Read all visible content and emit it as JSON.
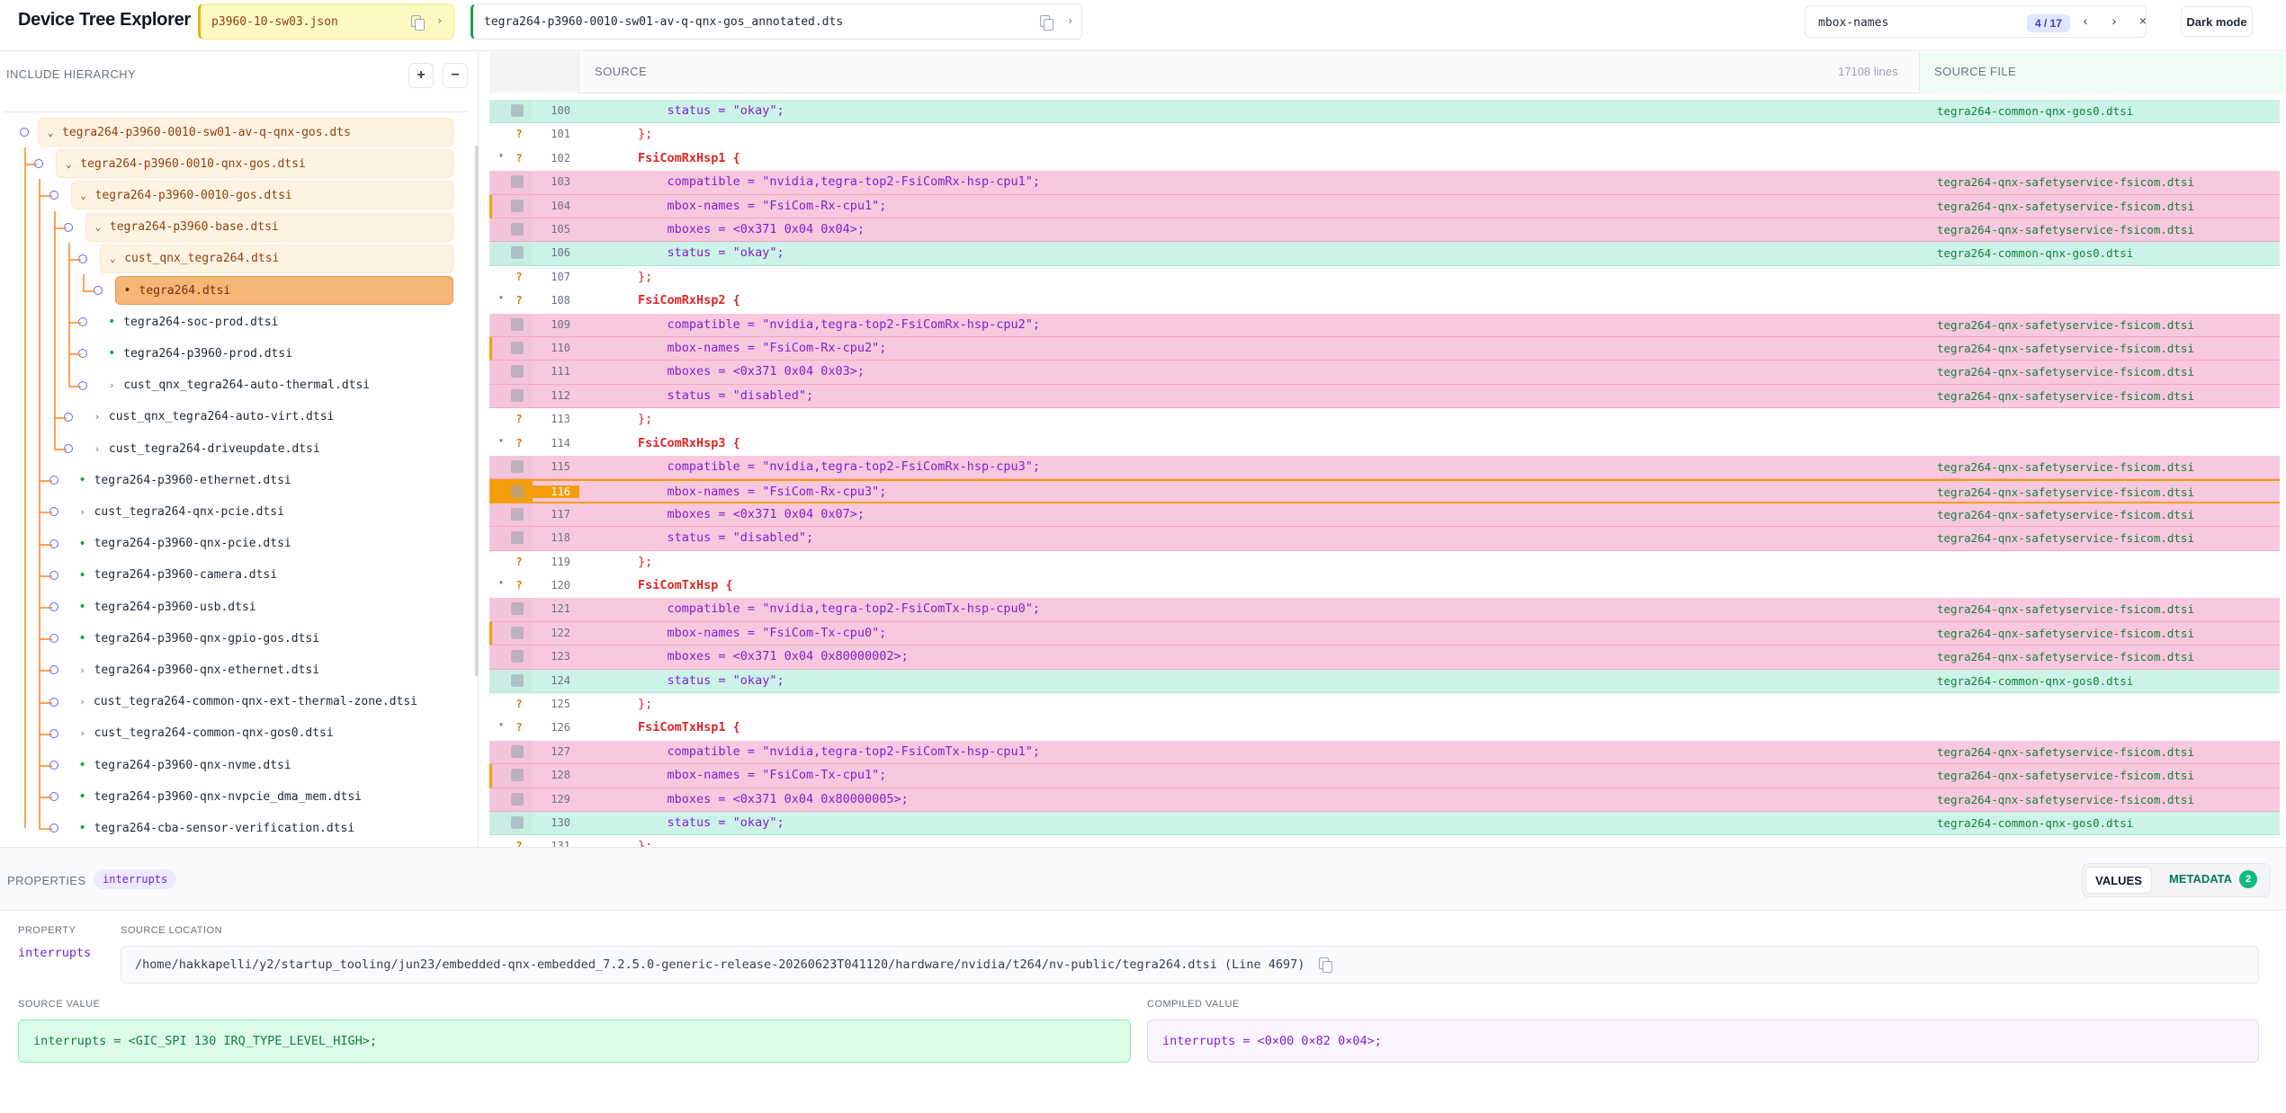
{
  "header": {
    "title": "Device Tree Explorer",
    "file_left": "p3960-10-sw03.json",
    "file_right": "tegra264-p3960-0010-sw01-av-q-qnx-gos_annotated.dts",
    "search_query": "mbox-names",
    "search_count": "4 / 17",
    "dark_mode_label": "Dark mode"
  },
  "sidebar": {
    "title": "INCLUDE HIERARCHY",
    "expand_label": "+",
    "collapse_label": "−",
    "nodes": [
      {
        "label": "tegra264-p3960-0010-sw01-av-q-qnx-gos.dts",
        "state": "open"
      },
      {
        "label": "tegra264-p3960-0010-qnx-gos.dtsi",
        "state": "open"
      },
      {
        "label": "tegra264-p3960-0010-gos.dtsi",
        "state": "open"
      },
      {
        "label": "tegra264-p3960-base.dtsi",
        "state": "open"
      },
      {
        "label": "cust_qnx_tegra264.dtsi",
        "state": "open"
      },
      {
        "label": "tegra264.dtsi",
        "state": "selected"
      },
      {
        "label": "tegra264-soc-prod.dtsi",
        "state": "leaf"
      },
      {
        "label": "tegra264-p3960-prod.dtsi",
        "state": "leaf"
      },
      {
        "label": "cust_qnx_tegra264-auto-thermal.dtsi",
        "state": "closed"
      },
      {
        "label": "cust_qnx_tegra264-auto-virt.dtsi",
        "state": "closed"
      },
      {
        "label": "cust_tegra264-driveupdate.dtsi",
        "state": "closed"
      },
      {
        "label": "tegra264-p3960-ethernet.dtsi",
        "state": "leaf"
      },
      {
        "label": "cust_tegra264-qnx-pcie.dtsi",
        "state": "closed"
      },
      {
        "label": "tegra264-p3960-qnx-pcie.dtsi",
        "state": "leaf"
      },
      {
        "label": "tegra264-p3960-camera.dtsi",
        "state": "leaf"
      },
      {
        "label": "tegra264-p3960-usb.dtsi",
        "state": "leaf"
      },
      {
        "label": "tegra264-p3960-qnx-gpio-gos.dtsi",
        "state": "leaf"
      },
      {
        "label": "tegra264-p3960-qnx-ethernet.dtsi",
        "state": "closed"
      },
      {
        "label": "cust_tegra264-common-qnx-ext-thermal-zone.dtsi",
        "state": "closed"
      },
      {
        "label": "cust_tegra264-common-qnx-gos0.dtsi",
        "state": "closed"
      },
      {
        "label": "tegra264-p3960-qnx-nvme.dtsi",
        "state": "leaf"
      },
      {
        "label": "tegra264-p3960-qnx-nvpcie_dma_mem.dtsi",
        "state": "leaf"
      },
      {
        "label": "tegra264-cba-sensor-verification.dtsi",
        "state": "leaf"
      }
    ]
  },
  "source": {
    "header_label": "SOURCE",
    "line_count": "17108 lines",
    "file_header": "SOURCE FILE",
    "lines": [
      {
        "n": "100",
        "code": "            status = \"okay\";",
        "file": "tegra264-common-qnx-gos0.dtsi",
        "kind": "teal"
      },
      {
        "n": "101",
        "code": "        };",
        "file": "",
        "kind": "plain"
      },
      {
        "n": "102",
        "code": "        FsiComRxHsp1 {",
        "file": "",
        "kind": "node"
      },
      {
        "n": "103",
        "code": "            compatible = \"nvidia,tegra-top2-FsiComRx-hsp-cpu1\";",
        "file": "tegra264-qnx-safetyservice-fsicom.dtsi",
        "kind": "pink"
      },
      {
        "n": "104",
        "code": "            mbox-names = \"FsiCom-Rx-cpu1\";",
        "file": "tegra264-qnx-safetyservice-fsicom.dtsi",
        "kind": "pinkbar"
      },
      {
        "n": "105",
        "code": "            mboxes = <0x371 0x04 0x04>;",
        "file": "tegra264-qnx-safetyservice-fsicom.dtsi",
        "kind": "pink"
      },
      {
        "n": "106",
        "code": "            status = \"okay\";",
        "file": "tegra264-common-qnx-gos0.dtsi",
        "kind": "teal"
      },
      {
        "n": "107",
        "code": "        };",
        "file": "",
        "kind": "plain"
      },
      {
        "n": "108",
        "code": "        FsiComRxHsp2 {",
        "file": "",
        "kind": "node"
      },
      {
        "n": "109",
        "code": "            compatible = \"nvidia,tegra-top2-FsiComRx-hsp-cpu2\";",
        "file": "tegra264-qnx-safetyservice-fsicom.dtsi",
        "kind": "pink"
      },
      {
        "n": "110",
        "code": "            mbox-names = \"FsiCom-Rx-cpu2\";",
        "file": "tegra264-qnx-safetyservice-fsicom.dtsi",
        "kind": "pinkbar"
      },
      {
        "n": "111",
        "code": "            mboxes = <0x371 0x04 0x03>;",
        "file": "tegra264-qnx-safetyservice-fsicom.dtsi",
        "kind": "pink"
      },
      {
        "n": "112",
        "code": "            status = \"disabled\";",
        "file": "tegra264-qnx-safetyservice-fsicom.dtsi",
        "kind": "pink"
      },
      {
        "n": "113",
        "code": "        };",
        "file": "",
        "kind": "plain"
      },
      {
        "n": "114",
        "code": "        FsiComRxHsp3 {",
        "file": "",
        "kind": "node"
      },
      {
        "n": "115",
        "code": "            compatible = \"nvidia,tegra-top2-FsiComRx-hsp-cpu3\";",
        "file": "tegra264-qnx-safetyservice-fsicom.dtsi",
        "kind": "pink"
      },
      {
        "n": "116",
        "code": "            mbox-names = \"FsiCom-Rx-cpu3\";",
        "file": "tegra264-qnx-safetyservice-fsicom.dtsi",
        "kind": "cur"
      },
      {
        "n": "117",
        "code": "            mboxes = <0x371 0x04 0x07>;",
        "file": "tegra264-qnx-safetyservice-fsicom.dtsi",
        "kind": "pink"
      },
      {
        "n": "118",
        "code": "            status = \"disabled\";",
        "file": "tegra264-qnx-safetyservice-fsicom.dtsi",
        "kind": "pink"
      },
      {
        "n": "119",
        "code": "        };",
        "file": "",
        "kind": "plain"
      },
      {
        "n": "120",
        "code": "        FsiComTxHsp {",
        "file": "",
        "kind": "node"
      },
      {
        "n": "121",
        "code": "            compatible = \"nvidia,tegra-top2-FsiComTx-hsp-cpu0\";",
        "file": "tegra264-qnx-safetyservice-fsicom.dtsi",
        "kind": "pink"
      },
      {
        "n": "122",
        "code": "            mbox-names = \"FsiCom-Tx-cpu0\";",
        "file": "tegra264-qnx-safetyservice-fsicom.dtsi",
        "kind": "pinkbar"
      },
      {
        "n": "123",
        "code": "            mboxes = <0x371 0x04 0x80000002>;",
        "file": "tegra264-qnx-safetyservice-fsicom.dtsi",
        "kind": "pink"
      },
      {
        "n": "124",
        "code": "            status = \"okay\";",
        "file": "tegra264-common-qnx-gos0.dtsi",
        "kind": "teal"
      },
      {
        "n": "125",
        "code": "        };",
        "file": "",
        "kind": "plain"
      },
      {
        "n": "126",
        "code": "        FsiComTxHsp1 {",
        "file": "",
        "kind": "node"
      },
      {
        "n": "127",
        "code": "            compatible = \"nvidia,tegra-top2-FsiComTx-hsp-cpu1\";",
        "file": "tegra264-qnx-safetyservice-fsicom.dtsi",
        "kind": "pink"
      },
      {
        "n": "128",
        "code": "            mbox-names = \"FsiCom-Tx-cpu1\";",
        "file": "tegra264-qnx-safetyservice-fsicom.dtsi",
        "kind": "pinkbar"
      },
      {
        "n": "129",
        "code": "            mboxes = <0x371 0x04 0x80000005>;",
        "file": "tegra264-qnx-safetyservice-fsicom.dtsi",
        "kind": "pink"
      },
      {
        "n": "130",
        "code": "            status = \"okay\";",
        "file": "tegra264-common-qnx-gos0.dtsi",
        "kind": "teal"
      },
      {
        "n": "131",
        "code": "        };",
        "file": "",
        "kind": "plain"
      }
    ]
  },
  "properties": {
    "title": "PROPERTIES",
    "selected_pill": "interrupts",
    "tab_values": "VALUES",
    "tab_metadata": "METADATA",
    "metadata_count": "2",
    "property_label": "PROPERTY",
    "property_name": "interrupts",
    "location_label": "SOURCE LOCATION",
    "location": "/home/hakkapelli/y2/startup_tooling/jun23/embedded-qnx-embedded_7.2.5.0-generic-release-20260623T041120/hardware/nvidia/t264/nv-public/tegra264.dtsi (Line 4697)",
    "source_value_label": "SOURCE VALUE",
    "source_value": "interrupts = <GIC_SPI 130 IRQ_TYPE_LEVEL_HIGH>;",
    "compiled_value_label": "COMPILED VALUE",
    "compiled_value": "interrupts = <0×00 0×82 0×04>;"
  }
}
